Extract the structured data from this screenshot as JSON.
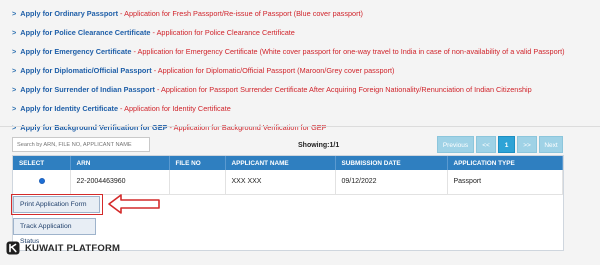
{
  "apply_links": [
    {
      "title": "Apply for Ordinary Passport",
      "desc": "Application for Fresh Passport/Re-issue of Passport (Blue cover passport)"
    },
    {
      "title": "Apply for Police Clearance Certificate",
      "desc": "Application for Police Clearance Certificate"
    },
    {
      "title": "Apply for Emergency Certificate",
      "desc": "Application for Emergency Certificate (White cover passport for one-way travel to India in case of non-availability of a valid Passport)"
    },
    {
      "title": "Apply for Diplomatic/Official Passport",
      "desc": "Application for Diplomatic/Official Passport (Maroon/Grey cover passport)"
    },
    {
      "title": "Apply for Surrender of Indian Passport",
      "desc": "Application for Passport Surrender Certificate After Acquiring Foreign Nationality/Renunciation of Indian Citizenship"
    },
    {
      "title": "Apply for Identity Certificate",
      "desc": "Application for Identity Certificate"
    },
    {
      "title": "Apply for Background Verification for GEP",
      "desc": "Application for Background Verification for GEP"
    }
  ],
  "arrow_glyph": ">",
  "search": {
    "placeholder": "Search by ARN, FILE NO, APPLICANT NAME"
  },
  "showing": "Showing:1/1",
  "pager": {
    "previous": "Previous",
    "first": "<<",
    "current": "1",
    "last": ">>",
    "next": "Next"
  },
  "table": {
    "headers": [
      "SELECT",
      "ARN",
      "FILE NO",
      "APPLICANT NAME",
      "SUBMISSION DATE",
      "APPLICATION TYPE"
    ],
    "rows": [
      {
        "arn": "22-2004463960",
        "file_no": "",
        "applicant_name": "XXX XXX",
        "submission_date": "09/12/2022",
        "application_type": "Passport"
      }
    ]
  },
  "actions": {
    "print": "Print Application Form",
    "track": "Track Application Status"
  },
  "brand": {
    "name": "KUWAIT PLATFORM"
  },
  "colors": {
    "link": "#1f5fa8",
    "desc": "#d0242b",
    "table_header": "#2f7fc0",
    "annotation": "#d42a2a"
  }
}
